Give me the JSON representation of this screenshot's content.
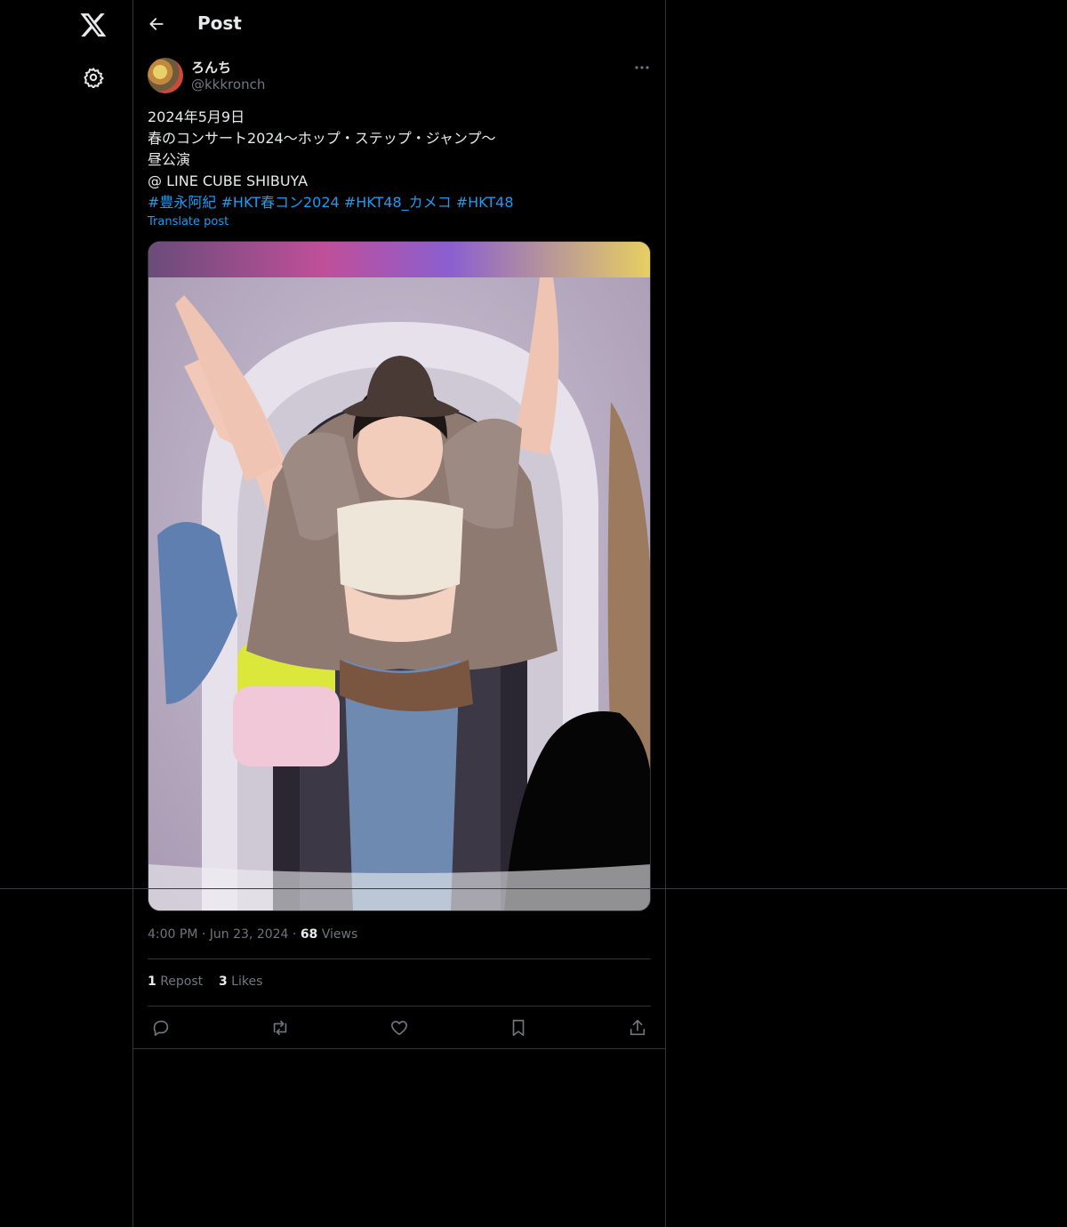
{
  "header": {
    "title": "Post"
  },
  "nav": {
    "logo_icon": "x-logo-icon",
    "settings_icon": "gear-icon"
  },
  "post": {
    "author": {
      "display_name": "ろんち",
      "handle": "@kkkronch"
    },
    "text_lines": [
      "2024年5月9日",
      "春のコンサート2024〜ホップ・ステップ・ジャンプ〜",
      "昼公演",
      "@ LINE CUBE SHIBUYA"
    ],
    "hashtags": [
      "#豊永阿紀",
      "#HKT春コン2024",
      "#HKT48_カメコ",
      "#HKT48"
    ],
    "translate_label": "Translate post",
    "time": "4:00 PM",
    "date": "Jun 23, 2024",
    "views_count": "68",
    "views_label": "Views",
    "reposts_count": "1",
    "reposts_label": "Repost",
    "likes_count": "3",
    "likes_label": "Likes"
  },
  "actions": [
    "reply-icon",
    "repost-icon",
    "like-icon",
    "bookmark-icon",
    "share-icon"
  ],
  "colors": {
    "accent": "#1d9bf0",
    "text": "#e7e9ea",
    "muted": "#71767b",
    "border": "#2f3336",
    "bg": "#000000"
  }
}
